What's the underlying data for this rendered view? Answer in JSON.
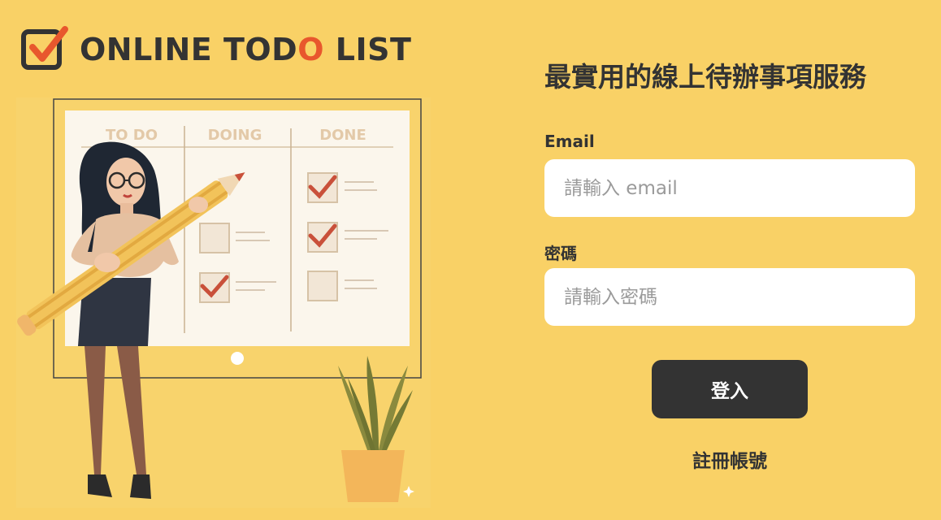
{
  "brand": {
    "logo_text_before": "ONLINE TOD",
    "logo_text_accent": "O",
    "logo_text_after": " LIST",
    "accent_color": "#e8572d",
    "background_color": "#f9d166"
  },
  "illustration": {
    "board_columns": [
      "TO DO",
      "DOING",
      "DONE"
    ],
    "icon": "todo-board-illustration"
  },
  "form": {
    "headline": "最實用的線上待辦事項服務",
    "email_label": "Email",
    "email_placeholder": "請輸入 email",
    "password_label": "密碼",
    "password_placeholder": "請輸入密碼",
    "login_button": "登入",
    "register_link": "註冊帳號"
  }
}
